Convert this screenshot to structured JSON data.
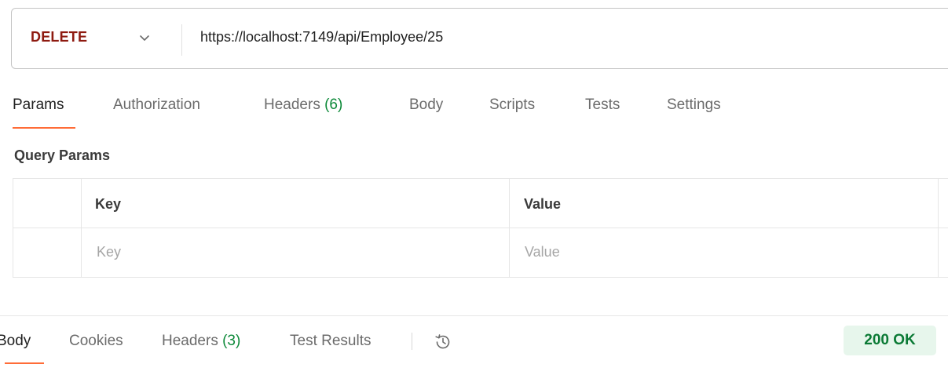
{
  "request": {
    "method": "DELETE",
    "url": "https://localhost:7149/api/Employee/25"
  },
  "request_tabs": [
    {
      "label": "Params",
      "count": ""
    },
    {
      "label": "Authorization",
      "count": ""
    },
    {
      "label": "Headers ",
      "count": "(6)"
    },
    {
      "label": "Body",
      "count": ""
    },
    {
      "label": "Scripts",
      "count": ""
    },
    {
      "label": "Tests",
      "count": ""
    },
    {
      "label": "Settings",
      "count": ""
    }
  ],
  "query_params": {
    "title": "Query Params",
    "columns": [
      "Key",
      "Value"
    ],
    "placeholders": {
      "key": "Key",
      "value": "Value"
    }
  },
  "response_tabs": [
    {
      "label": "Body",
      "count": ""
    },
    {
      "label": "Cookies",
      "count": ""
    },
    {
      "label": "Headers ",
      "count": "(3)"
    },
    {
      "label": "Test Results",
      "count": ""
    }
  ],
  "response_status": "200 OK",
  "icons": {
    "method_dropdown": "chevron-down-icon",
    "history": "history-icon"
  },
  "colors": {
    "method": "#8e1a10",
    "active_tab_underline": "#ff6c37",
    "count": "#0e8a3a",
    "status_bg": "#e7f6ec",
    "status_text": "#0b7a35"
  }
}
